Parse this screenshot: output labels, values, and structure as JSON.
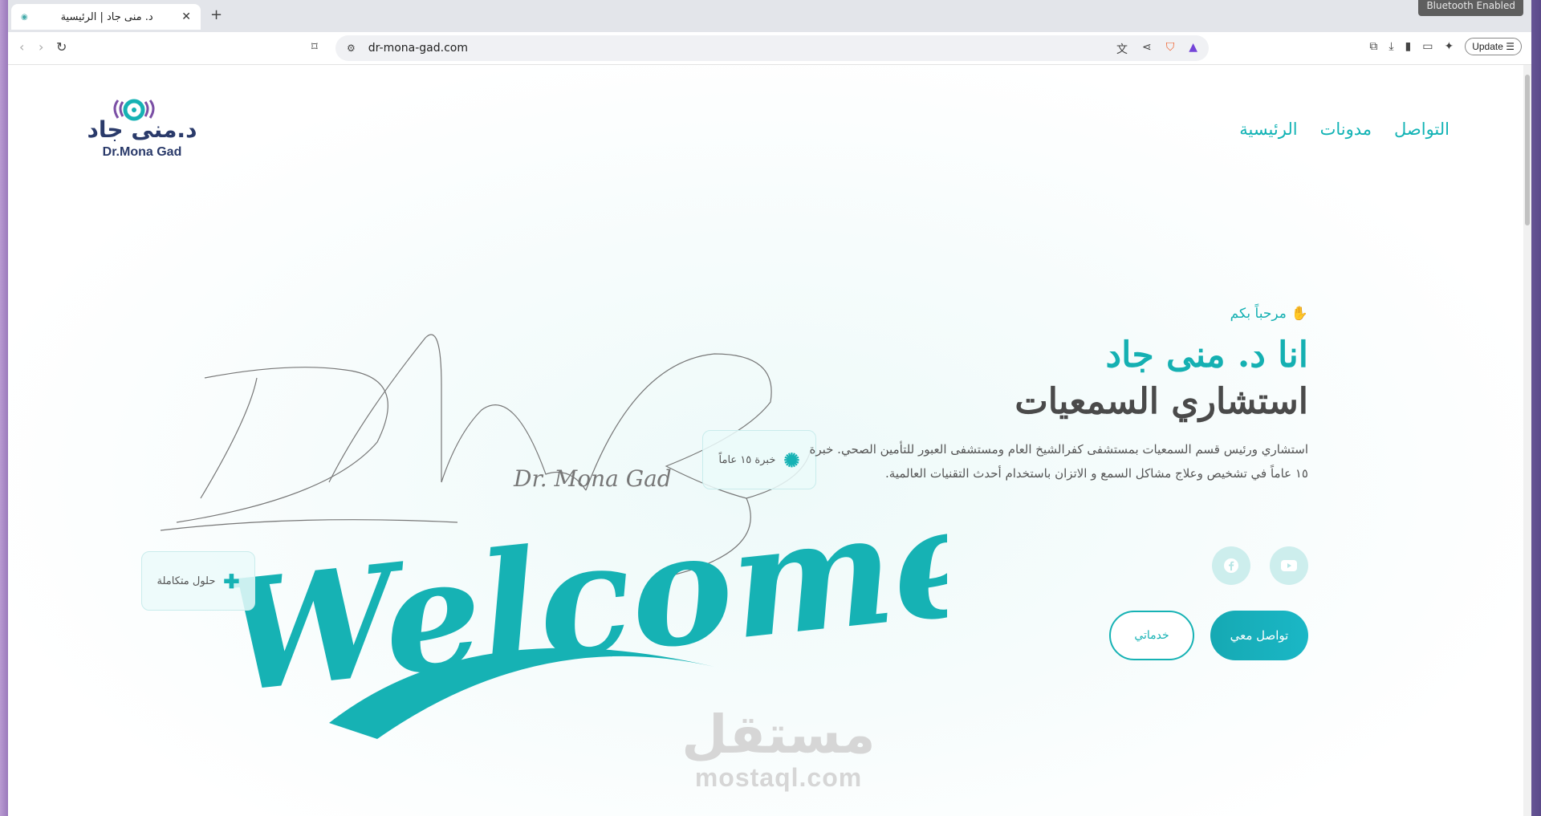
{
  "browser": {
    "tab_title": "د. منى جاد | الرئيسية",
    "url": "dr-mona-gad.com",
    "update_label": "Update",
    "notification": "Bluetooth Enabled"
  },
  "header": {
    "logo_ar": "د.منى جاد",
    "logo_en": "Dr.Mona Gad",
    "nav": [
      "الرئيسية",
      "مدونات",
      "التواصل"
    ]
  },
  "hero": {
    "greeting": "مرحباً بكم",
    "title_line1": "انا د. منى جاد",
    "title_line2": "استشاري السمعيات",
    "bio": "استشاري ورئيس قسم السمعيات بمستشفى كفرالشيخ العام ومستشفى العبور للتأمين الصحي. خبرة ١٥ عاماً في تشخيص وعلاج مشاكل السمع و الاتزان باستخدام أحدث التقنيات العالمية.",
    "primary_button": "تواصل معي",
    "secondary_button": "خدماتي",
    "social": [
      "youtube-icon",
      "facebook-icon"
    ]
  },
  "art": {
    "signature": "Dr. Mona Gad",
    "welcome": "Welcome",
    "badge_experience": "خبرة ١٥ عاماً",
    "badge_solutions": "حلول متكاملة"
  },
  "watermark": {
    "ar": "مستقل",
    "en": "mostaql.com"
  },
  "colors": {
    "accent": "#16b2b4",
    "heading_dark": "#4a4a4a",
    "logo_navy": "#2a3a6a"
  }
}
